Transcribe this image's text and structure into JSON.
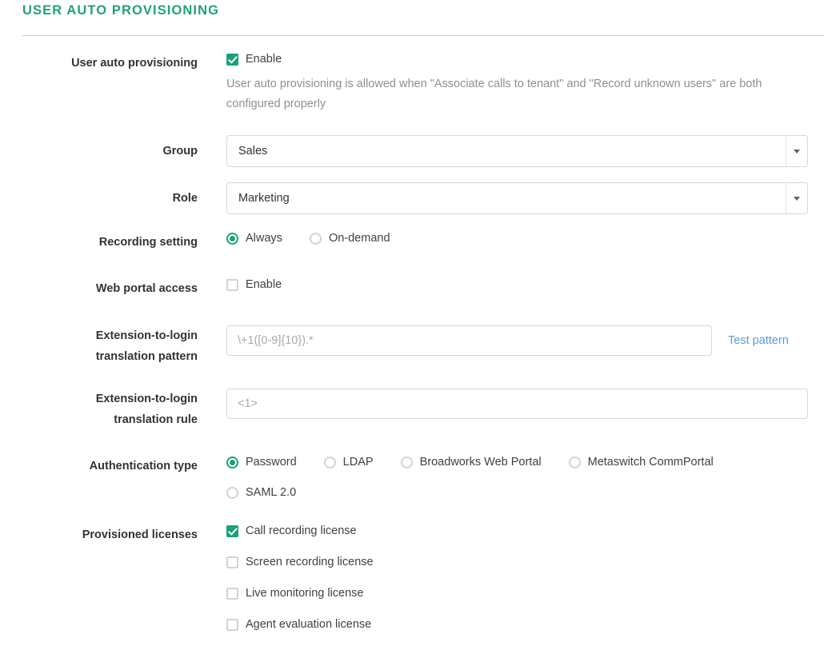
{
  "header": {
    "title": "User auto provisioning"
  },
  "form": {
    "user_auto_provisioning": {
      "label": "User auto provisioning",
      "enable_label": "Enable",
      "enable_checked": true,
      "help_text": "User auto provisioning is allowed when \"Associate calls to tenant\" and \"Record unknown users\" are both configured properly"
    },
    "group": {
      "label": "Group",
      "value": "Sales"
    },
    "role": {
      "label": "Role",
      "value": "Marketing"
    },
    "recording_setting": {
      "label": "Recording setting",
      "options": [
        {
          "label": "Always",
          "selected": true
        },
        {
          "label": "On-demand",
          "selected": false
        }
      ]
    },
    "web_portal_access": {
      "label": "Web portal access",
      "enable_label": "Enable",
      "enable_checked": false
    },
    "translation_pattern": {
      "label_line1": "Extension-to-login",
      "label_line2": "translation pattern",
      "value": "",
      "placeholder": "\\+1([0-9]{10}).*",
      "test_link_label": "Test pattern"
    },
    "translation_rule": {
      "label_line1": "Extension-to-login",
      "label_line2": "translation rule",
      "value": "",
      "placeholder": "<1>"
    },
    "authentication_type": {
      "label": "Authentication type",
      "options": [
        {
          "label": "Password",
          "selected": true
        },
        {
          "label": "LDAP",
          "selected": false
        },
        {
          "label": "Broadworks Web Portal",
          "selected": false
        },
        {
          "label": "Metaswitch CommPortal",
          "selected": false
        },
        {
          "label": "SAML 2.0",
          "selected": false
        }
      ]
    },
    "provisioned_licenses": {
      "label": "Provisioned licenses",
      "options": [
        {
          "label": "Call recording license",
          "checked": true
        },
        {
          "label": "Screen recording license",
          "checked": false
        },
        {
          "label": "Live monitoring license",
          "checked": false
        },
        {
          "label": "Agent evaluation license",
          "checked": false
        }
      ]
    }
  },
  "colors": {
    "accent_green": "#21a179",
    "link_blue": "#5b9bd5",
    "help_gray": "#8a9196"
  }
}
